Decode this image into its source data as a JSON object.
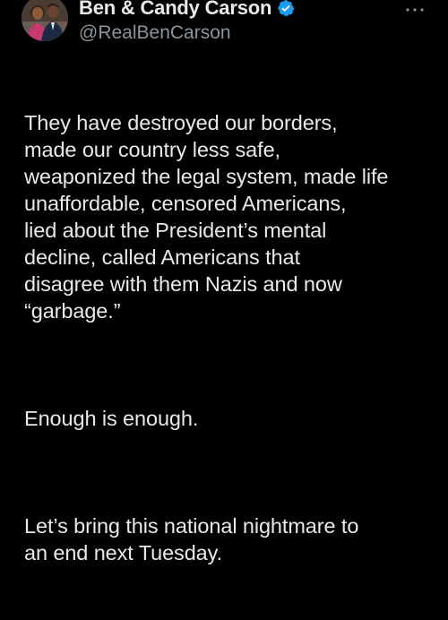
{
  "author": {
    "display_name": "Ben & Candy Carson",
    "handle": "@RealBenCarson",
    "verified_icon": "verified-badge-icon",
    "more_icon": "more-options-icon",
    "colors": {
      "verified": "#1d9bf0",
      "name": "#e7e9ea",
      "handle": "#8b949c"
    }
  },
  "tweet": {
    "paragraphs": [
      "They have destroyed our borders,\nmade our country less safe,\nweaponized the legal system, made life\nunaffordable, censored Americans,\nlied about the President’s mental\ndecline, called Americans that\ndisagree with them Nazis and now\n“garbage.”",
      "Enough is enough.",
      "Let’s bring this national nightmare to\nan end next Tuesday."
    ]
  },
  "background": "#000000"
}
